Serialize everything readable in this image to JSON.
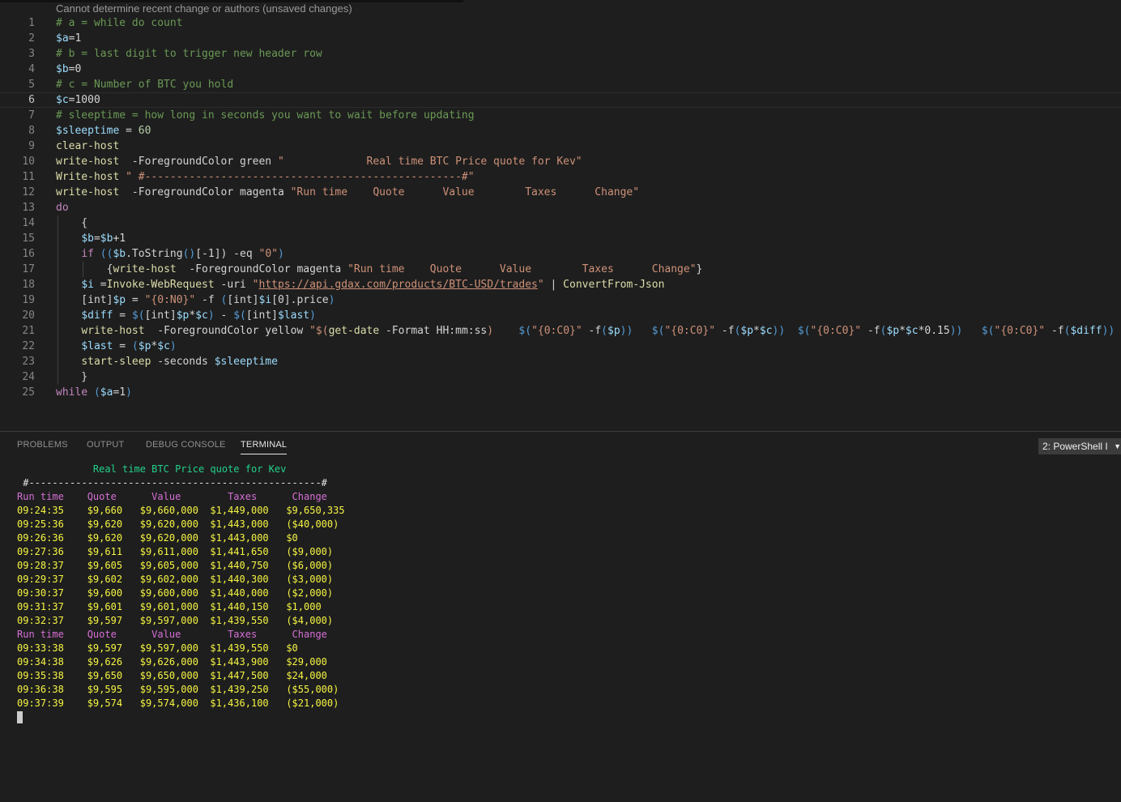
{
  "editor": {
    "blame_text": "Cannot determine recent change or authors (unsaved changes)",
    "current_line": 6,
    "lines": [
      {
        "n": "1",
        "tokens": [
          {
            "t": "# a = while do count",
            "c": "cm"
          }
        ]
      },
      {
        "n": "2",
        "tokens": [
          {
            "t": "$a",
            "c": "var"
          },
          {
            "t": "=1",
            "c": "plain"
          }
        ]
      },
      {
        "n": "3",
        "tokens": [
          {
            "t": "# b = last digit to trigger new header row",
            "c": "cm"
          }
        ]
      },
      {
        "n": "4",
        "tokens": [
          {
            "t": "$b",
            "c": "var"
          },
          {
            "t": "=0",
            "c": "plain"
          }
        ]
      },
      {
        "n": "5",
        "tokens": [
          {
            "t": "# c = Number of BTC you hold",
            "c": "cm"
          }
        ]
      },
      {
        "n": "6",
        "tokens": [
          {
            "t": "$c",
            "c": "var"
          },
          {
            "t": "=1000",
            "c": "plain"
          }
        ]
      },
      {
        "n": "7",
        "tokens": [
          {
            "t": "# sleeptime = how long in seconds you want to wait before updating",
            "c": "cm"
          }
        ]
      },
      {
        "n": "8",
        "tokens": [
          {
            "t": "$sleeptime",
            "c": "var"
          },
          {
            "t": " = ",
            "c": "plain"
          },
          {
            "t": "60",
            "c": "num"
          }
        ]
      },
      {
        "n": "9",
        "tokens": [
          {
            "t": "clear-host",
            "c": "cmd"
          }
        ]
      },
      {
        "n": "10",
        "tokens": [
          {
            "t": "write-host",
            "c": "cmd"
          },
          {
            "t": "  -ForegroundColor green ",
            "c": "plain"
          },
          {
            "t": "\"             Real time BTC Price quote for Kev\"",
            "c": "str"
          }
        ]
      },
      {
        "n": "11",
        "tokens": [
          {
            "t": "Write-host",
            "c": "cmd"
          },
          {
            "t": " ",
            "c": "plain"
          },
          {
            "t": "\" #--------------------------------------------------#\"",
            "c": "str"
          }
        ]
      },
      {
        "n": "12",
        "tokens": [
          {
            "t": "write-host",
            "c": "cmd"
          },
          {
            "t": "  -ForegroundColor magenta ",
            "c": "plain"
          },
          {
            "t": "\"Run time    Quote      Value        Taxes      Change\"",
            "c": "str"
          }
        ]
      },
      {
        "n": "13",
        "tokens": [
          {
            "t": "do",
            "c": "kw"
          }
        ]
      },
      {
        "n": "14",
        "guide": 1,
        "tokens": [
          {
            "t": "    {",
            "c": "plain"
          }
        ]
      },
      {
        "n": "15",
        "guide": 1,
        "tokens": [
          {
            "t": "    ",
            "c": "plain"
          },
          {
            "t": "$b",
            "c": "var"
          },
          {
            "t": "=",
            "c": "plain"
          },
          {
            "t": "$b",
            "c": "var"
          },
          {
            "t": "+1",
            "c": "plain"
          }
        ]
      },
      {
        "n": "16",
        "guide": 1,
        "tokens": [
          {
            "t": "    ",
            "c": "plain"
          },
          {
            "t": "if",
            "c": "kw"
          },
          {
            "t": " ((",
            "c": "paren"
          },
          {
            "t": "$b",
            "c": "var"
          },
          {
            "t": ".ToString",
            "c": "plain"
          },
          {
            "t": "()",
            "c": "paren"
          },
          {
            "t": "[-1]) -eq ",
            "c": "plain"
          },
          {
            "t": "\"0\"",
            "c": "str"
          },
          {
            "t": ")",
            "c": "paren"
          }
        ]
      },
      {
        "n": "17",
        "guide": 2,
        "tokens": [
          {
            "t": "        {",
            "c": "plain"
          },
          {
            "t": "write-host",
            "c": "cmd"
          },
          {
            "t": "  -ForegroundColor magenta ",
            "c": "plain"
          },
          {
            "t": "\"Run time    Quote      Value        Taxes      Change\"",
            "c": "str"
          },
          {
            "t": "}",
            "c": "plain"
          }
        ]
      },
      {
        "n": "18",
        "guide": 1,
        "tokens": [
          {
            "t": "    ",
            "c": "plain"
          },
          {
            "t": "$i",
            "c": "var"
          },
          {
            "t": " =",
            "c": "plain"
          },
          {
            "t": "Invoke-WebRequest",
            "c": "cmd"
          },
          {
            "t": " -uri ",
            "c": "plain"
          },
          {
            "t": "\"",
            "c": "str"
          },
          {
            "t": "https://api.gdax.com/products/BTC-USD/trades",
            "c": "link"
          },
          {
            "t": "\"",
            "c": "str"
          },
          {
            "t": " | ",
            "c": "plain"
          },
          {
            "t": "ConvertFrom-Json",
            "c": "cmd"
          }
        ]
      },
      {
        "n": "19",
        "guide": 1,
        "tokens": [
          {
            "t": "    [int]",
            "c": "plain"
          },
          {
            "t": "$p",
            "c": "var"
          },
          {
            "t": " = ",
            "c": "plain"
          },
          {
            "t": "\"{0:N0}\"",
            "c": "str"
          },
          {
            "t": " -f ",
            "c": "plain"
          },
          {
            "t": "(",
            "c": "paren"
          },
          {
            "t": "[int]",
            "c": "plain"
          },
          {
            "t": "$i",
            "c": "var"
          },
          {
            "t": "[0].price",
            "c": "plain"
          },
          {
            "t": ")",
            "c": "paren"
          }
        ]
      },
      {
        "n": "20",
        "guide": 1,
        "tokens": [
          {
            "t": "    ",
            "c": "plain"
          },
          {
            "t": "$diff",
            "c": "var"
          },
          {
            "t": " = ",
            "c": "plain"
          },
          {
            "t": "$(",
            "c": "paren"
          },
          {
            "t": "[int]",
            "c": "plain"
          },
          {
            "t": "$p",
            "c": "var"
          },
          {
            "t": "*",
            "c": "plain"
          },
          {
            "t": "$c",
            "c": "var"
          },
          {
            "t": ")",
            "c": "paren"
          },
          {
            "t": " - ",
            "c": "plain"
          },
          {
            "t": "$(",
            "c": "paren"
          },
          {
            "t": "[int]",
            "c": "plain"
          },
          {
            "t": "$last",
            "c": "var"
          },
          {
            "t": ")",
            "c": "paren"
          }
        ]
      },
      {
        "n": "21",
        "guide": 1,
        "tokens": [
          {
            "t": "    ",
            "c": "plain"
          },
          {
            "t": "write-host",
            "c": "cmd"
          },
          {
            "t": "  -ForegroundColor yellow ",
            "c": "plain"
          },
          {
            "t": "\"$(",
            "c": "str"
          },
          {
            "t": "get-date",
            "c": "cmd"
          },
          {
            "t": " -Format HH:mm:ss",
            "c": "plain"
          },
          {
            "t": ")    ",
            "c": "str"
          },
          {
            "t": "$(",
            "c": "paren"
          },
          {
            "t": "\"{0:C0}\"",
            "c": "str"
          },
          {
            "t": " -f",
            "c": "plain"
          },
          {
            "t": "(",
            "c": "paren"
          },
          {
            "t": "$p",
            "c": "var"
          },
          {
            "t": "))",
            "c": "paren"
          },
          {
            "t": "   ",
            "c": "str"
          },
          {
            "t": "$(",
            "c": "paren"
          },
          {
            "t": "\"{0:C0}\"",
            "c": "str"
          },
          {
            "t": " -f",
            "c": "plain"
          },
          {
            "t": "(",
            "c": "paren"
          },
          {
            "t": "$p",
            "c": "var"
          },
          {
            "t": "*",
            "c": "plain"
          },
          {
            "t": "$c",
            "c": "var"
          },
          {
            "t": "))",
            "c": "paren"
          },
          {
            "t": "  ",
            "c": "str"
          },
          {
            "t": "$(",
            "c": "paren"
          },
          {
            "t": "\"{0:C0}\"",
            "c": "str"
          },
          {
            "t": " -f",
            "c": "plain"
          },
          {
            "t": "(",
            "c": "paren"
          },
          {
            "t": "$p",
            "c": "var"
          },
          {
            "t": "*",
            "c": "plain"
          },
          {
            "t": "$c",
            "c": "var"
          },
          {
            "t": "*0.15",
            "c": "plain"
          },
          {
            "t": "))",
            "c": "paren"
          },
          {
            "t": "   ",
            "c": "str"
          },
          {
            "t": "$(",
            "c": "paren"
          },
          {
            "t": "\"{0:C0}\"",
            "c": "str"
          },
          {
            "t": " -f",
            "c": "plain"
          },
          {
            "t": "(",
            "c": "paren"
          },
          {
            "t": "$diff",
            "c": "var"
          },
          {
            "t": "))",
            "c": "paren"
          },
          {
            "t": " \"",
            "c": "str"
          }
        ]
      },
      {
        "n": "22",
        "guide": 1,
        "tokens": [
          {
            "t": "    ",
            "c": "plain"
          },
          {
            "t": "$last",
            "c": "var"
          },
          {
            "t": " = ",
            "c": "plain"
          },
          {
            "t": "(",
            "c": "paren"
          },
          {
            "t": "$p",
            "c": "var"
          },
          {
            "t": "*",
            "c": "plain"
          },
          {
            "t": "$c",
            "c": "var"
          },
          {
            "t": ")",
            "c": "paren"
          }
        ]
      },
      {
        "n": "23",
        "guide": 1,
        "tokens": [
          {
            "t": "    ",
            "c": "plain"
          },
          {
            "t": "start-sleep",
            "c": "cmd"
          },
          {
            "t": " -seconds ",
            "c": "plain"
          },
          {
            "t": "$sleeptime",
            "c": "var"
          }
        ]
      },
      {
        "n": "24",
        "guide": 1,
        "tokens": [
          {
            "t": "    }",
            "c": "plain"
          }
        ]
      },
      {
        "n": "25",
        "tokens": [
          {
            "t": "while",
            "c": "kw"
          },
          {
            "t": " (",
            "c": "paren"
          },
          {
            "t": "$a",
            "c": "var"
          },
          {
            "t": "=1",
            "c": "plain"
          },
          {
            "t": ")",
            "c": "paren"
          }
        ]
      }
    ]
  },
  "panel": {
    "tabs": [
      {
        "label": "PROBLEMS",
        "active": false
      },
      {
        "label": "OUTPUT",
        "active": false
      },
      {
        "label": "DEBUG CONSOLE",
        "active": false
      },
      {
        "label": "TERMINAL",
        "active": true
      }
    ],
    "terminal_select": "2: PowerShell I",
    "terminal_lines": [
      {
        "text": "             Real time BTC Price quote for Kev",
        "color": "green"
      },
      {
        "text": " #--------------------------------------------------#",
        "color": "white"
      },
      {
        "text": "Run time    Quote      Value        Taxes      Change",
        "color": "mag"
      },
      {
        "text": "09:24:35    $9,660   $9,660,000  $1,449,000   $9,650,335",
        "color": "yel"
      },
      {
        "text": "09:25:36    $9,620   $9,620,000  $1,443,000   ($40,000)",
        "color": "yel"
      },
      {
        "text": "09:26:36    $9,620   $9,620,000  $1,443,000   $0",
        "color": "yel"
      },
      {
        "text": "09:27:36    $9,611   $9,611,000  $1,441,650   ($9,000)",
        "color": "yel"
      },
      {
        "text": "09:28:37    $9,605   $9,605,000  $1,440,750   ($6,000)",
        "color": "yel"
      },
      {
        "text": "09:29:37    $9,602   $9,602,000  $1,440,300   ($3,000)",
        "color": "yel"
      },
      {
        "text": "09:30:37    $9,600   $9,600,000  $1,440,000   ($2,000)",
        "color": "yel"
      },
      {
        "text": "09:31:37    $9,601   $9,601,000  $1,440,150   $1,000",
        "color": "yel"
      },
      {
        "text": "09:32:37    $9,597   $9,597,000  $1,439,550   ($4,000)",
        "color": "yel"
      },
      {
        "text": "Run time    Quote      Value        Taxes      Change",
        "color": "mag"
      },
      {
        "text": "09:33:38    $9,597   $9,597,000  $1,439,550   $0",
        "color": "yel"
      },
      {
        "text": "09:34:38    $9,626   $9,626,000  $1,443,900   $29,000",
        "color": "yel"
      },
      {
        "text": "09:35:38    $9,650   $9,650,000  $1,447,500   $24,000",
        "color": "yel"
      },
      {
        "text": "09:36:38    $9,595   $9,595,000  $1,439,250   ($55,000)",
        "color": "yel"
      },
      {
        "text": "09:37:39    $9,574   $9,574,000  $1,436,100   ($21,000)",
        "color": "yel"
      }
    ]
  },
  "colors": {
    "background": "#1e1e1e",
    "comment": "#6a9955",
    "variable": "#9cdcfe",
    "command": "#dcdcaa",
    "keyword": "#c586c0",
    "string": "#ce9178",
    "term_green": "#23d18b",
    "term_magenta": "#d670d6",
    "term_yellow": "#f5f543"
  }
}
